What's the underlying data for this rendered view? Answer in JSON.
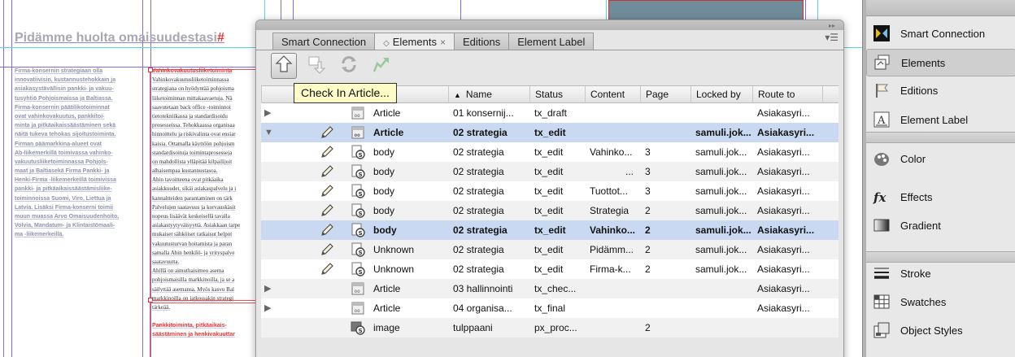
{
  "document": {
    "heading": "Pidämme huolta omaisuudestasi",
    "heading_mark": "#",
    "column1": [
      "Firma-konsernin strategiaan olla",
      "innovatiivisin, kustannustehokkain ja",
      "asiakasystävällisin pankki- ja vakuu-",
      "tusyhtiö Pohjoismaissa ja Baltiassa.",
      "Firma-konsernin päätilikotoiminnat",
      "ovat vahinkovakuutus, pankkitoi-",
      "minta ja pitkäaikaissäästäminen sekä",
      "näitä tukeva tehokas sijoitustoiminta.",
      "Firman päämarkkina-alueet ovat",
      "Ab-liikemerkillä toimivassa vahinko-",
      "vakuutusliiketoiminnassa Pohjois-",
      "maat ja Baltiasekä Firma Pankki- ja",
      "Henki-Firma -liikemerkeillä toimivissa",
      "pankki- ja pitkäaikaissäästämisliike-",
      "toiminnoissa Suomi, Viro, Liettua ja",
      "Latvia. Lisäksi Firma-konserni toimii",
      "muun muassa Arvo Omaisuudenhoito,",
      "Volvia, Mandatum- ja Klintaistömaali-",
      "ma -liikemerkeillä."
    ],
    "column2": [
      {
        "text": "Vahinkovakuutusliiketoiminta",
        "red": true
      },
      {
        "text": "Vahinkovakuutusliiketoiminnassa",
        "red": false
      },
      {
        "text": "strategiana on hyödyntää pohjoisma",
        "red": false
      },
      {
        "text": "liiketoiminnan mittakaavaetuja. Nä",
        "red": false
      },
      {
        "text": "saavutetaan back office -toiminnoi",
        "red": false
      },
      {
        "text": "tietotekniikassa ja standardisoidu",
        "red": false
      },
      {
        "text": "prosesseissa. Tehokkaassa organisaa",
        "red": false
      },
      {
        "text": "hinnoittelu ja riskivalinta ovat ensiar",
        "red": false
      },
      {
        "text": "kaisia. Ottamalla käyttöön pohjoism",
        "red": false
      },
      {
        "text": "standardisoituja toimintaprosesseja",
        "red": false
      },
      {
        "text": "on mahdollista ylläpitää kilpailijoit",
        "red": false
      },
      {
        "text": "alhaisempaa kustannustasoa.",
        "red": false
      },
      {
        "text": "Ahin tavoitteena ovat pitkäaika",
        "red": false
      },
      {
        "text": "asiakkuudet, sikäi asiakaspalvelu ja i",
        "red": false
      },
      {
        "text": "kannaltteiden parantaminen on tärk",
        "red": false
      },
      {
        "text": "Palvelujen saatavuus ja korvauskäsit",
        "red": false
      },
      {
        "text": "nopeus lisäävät keskeisellä tavalla",
        "red": false
      },
      {
        "text": "asiakastyytyväisyyttä. Asiakkaan tarpe",
        "red": false
      },
      {
        "text": "mukaiset sähköiset ratkaisut helpot",
        "red": false
      },
      {
        "text": "vakuutusturvan hoitamista ja paran",
        "red": false
      },
      {
        "text": "samalla Abin henkilö- ja yrityspalve",
        "red": false
      },
      {
        "text": "saatavuutta.",
        "red": false
      },
      {
        "text": "Ahillä on aimuthaisimeo asema",
        "red": false
      },
      {
        "text": "pohjoismaisilla markkinoilla, ja se a",
        "red": false
      },
      {
        "text": "säilyttää asemansa. Myös kasvu Bal",
        "red": false
      },
      {
        "text": "markkinoilla on jatkossakin strategi",
        "red": false
      },
      {
        "text": "tärkeää.",
        "red": false
      },
      {
        "text": "",
        "red": false
      },
      {
        "text": "Pankkitoiminta, pitkäaikais-",
        "red": true
      },
      {
        "text": "säästäminen ja henkivakuuttar",
        "red": true
      }
    ]
  },
  "panel": {
    "tabs": [
      {
        "label": "Smart Connection",
        "active": false,
        "diamond": false,
        "close": false
      },
      {
        "label": "Elements",
        "active": true,
        "diamond": true,
        "close": true
      },
      {
        "label": "Editions",
        "active": false,
        "diamond": false,
        "close": false
      },
      {
        "label": "Element Label",
        "active": false,
        "diamond": false,
        "close": false
      }
    ],
    "diamond_glyph": "◇",
    "close_glyph": "×",
    "collapse_glyph": "▸▸",
    "menu_glyph": "▾☰",
    "toolbar": [
      {
        "name": "check-in-icon",
        "pressed": true
      },
      {
        "name": "check-out-icon",
        "pressed": false
      },
      {
        "name": "update-icon",
        "pressed": false
      },
      {
        "name": "open-in-icon",
        "pressed": false
      }
    ],
    "tooltip": "Check In Article...",
    "columns": [
      {
        "key": "name",
        "label": "Name",
        "sort": "▲"
      },
      {
        "key": "status",
        "label": "Status",
        "sort": ""
      },
      {
        "key": "content",
        "label": "Content",
        "sort": ""
      },
      {
        "key": "page",
        "label": "Page",
        "sort": ""
      },
      {
        "key": "locked_by",
        "label": "Locked by",
        "sort": ""
      },
      {
        "key": "route_to",
        "label": "Route to",
        "sort": ""
      }
    ],
    "rows": [
      {
        "expander": "▶",
        "pencil": false,
        "icon": "article-icon",
        "type": "Article",
        "name": "01 konsernij...",
        "status": "tx_draft",
        "content": "",
        "page": "",
        "locked_by": "",
        "route_to": "Asiakasyri...",
        "selected": false,
        "bold": false
      },
      {
        "expander": "▼",
        "pencil": true,
        "icon": "article-icon",
        "type": "Article",
        "name": "02 strategia",
        "status": "tx_edit",
        "content": "",
        "page": "",
        "locked_by": "samuli.jok...",
        "route_to": "Asiakasyri...",
        "selected": true,
        "bold": true
      },
      {
        "expander": "",
        "pencil": true,
        "icon": "text-component-icon",
        "type": "body",
        "name": "02 strategia",
        "status": "tx_edit",
        "content": "Vahinko...",
        "page": "3",
        "locked_by": "samuli.jok...",
        "route_to": "Asiakasyri...",
        "selected": false,
        "bold": false
      },
      {
        "expander": "",
        "pencil": true,
        "icon": "text-component-icon",
        "type": "body",
        "name": "02 strategia",
        "status": "tx_edit",
        "content": "...",
        "page": "3",
        "locked_by": "samuli.jok...",
        "route_to": "Asiakasyri...",
        "selected": false,
        "bold": false
      },
      {
        "expander": "",
        "pencil": true,
        "icon": "text-component-icon",
        "type": "body",
        "name": "02 strategia",
        "status": "tx_edit",
        "content": "Tuottot...",
        "page": "3",
        "locked_by": "samuli.jok...",
        "route_to": "Asiakasyri...",
        "selected": false,
        "bold": false
      },
      {
        "expander": "",
        "pencil": true,
        "icon": "text-component-icon",
        "type": "body",
        "name": "02 strategia",
        "status": "tx_edit",
        "content": "Strategia",
        "page": "2",
        "locked_by": "samuli.jok...",
        "route_to": "Asiakasyri...",
        "selected": false,
        "bold": false
      },
      {
        "expander": "",
        "pencil": true,
        "icon": "text-component-icon",
        "type": "body",
        "name": "02 strategia",
        "status": "tx_edit",
        "content": "Vahinko...",
        "page": "2",
        "locked_by": "samuli.jok...",
        "route_to": "Asiakasyri...",
        "selected": true,
        "bold": true
      },
      {
        "expander": "",
        "pencil": true,
        "icon": "text-component-icon",
        "type": "Unknown",
        "name": "02 strategia",
        "status": "tx_edit",
        "content": "Pidämm...",
        "page": "2",
        "locked_by": "samuli.jok...",
        "route_to": "Asiakasyri...",
        "selected": false,
        "bold": false
      },
      {
        "expander": "",
        "pencil": true,
        "icon": "text-component-icon",
        "type": "Unknown",
        "name": "02 strategia",
        "status": "tx_edit",
        "content": "Firma-k...",
        "page": "2",
        "locked_by": "samuli.jok...",
        "route_to": "Asiakasyri...",
        "selected": false,
        "bold": false
      },
      {
        "expander": "▶",
        "pencil": false,
        "icon": "article-icon",
        "type": "Article",
        "name": "03 hallinnointi",
        "status": "tx_chec...",
        "content": "",
        "page": "",
        "locked_by": "",
        "route_to": "Asiakasyri...",
        "selected": false,
        "bold": false
      },
      {
        "expander": "▶",
        "pencil": false,
        "icon": "article-icon",
        "type": "Article",
        "name": "04 organisa...",
        "status": "tx_final",
        "content": "",
        "page": "",
        "locked_by": "",
        "route_to": "Asiakasyri...",
        "selected": false,
        "bold": false
      },
      {
        "expander": "",
        "pencil": false,
        "icon": "image-component-icon",
        "type": "image",
        "name": "tulppaani",
        "status": "px_proc...",
        "content": "",
        "page": "2",
        "locked_by": "",
        "route_to": "",
        "selected": false,
        "bold": false
      }
    ]
  },
  "dock": {
    "groups": [
      [
        {
          "label": "Smart Connection",
          "icon": "smart-connection-icon",
          "selected": false
        },
        {
          "label": "Elements",
          "icon": "elements-icon",
          "selected": true
        },
        {
          "label": "Editions",
          "icon": "editions-icon",
          "selected": false
        },
        {
          "label": "Element Label",
          "icon": "element-label-icon",
          "selected": false
        }
      ],
      [
        {
          "label": "Color",
          "icon": "color-icon",
          "selected": false
        },
        {
          "label": "Effects",
          "icon": "effects-icon",
          "selected": false
        },
        {
          "label": "Gradient",
          "icon": "gradient-icon",
          "selected": false
        }
      ],
      [
        {
          "label": "Stroke",
          "icon": "stroke-icon",
          "selected": false
        },
        {
          "label": "Swatches",
          "icon": "swatches-icon",
          "selected": false
        },
        {
          "label": "Object Styles",
          "icon": "object-styles-icon",
          "selected": false
        }
      ]
    ]
  },
  "colors": {
    "selection": "#cad9f2",
    "tooltip_bg": "#fdfcc6",
    "guide_purple": "#8a6ad8",
    "guide_cyan": "#52d8e0",
    "frame_red": "#e55555"
  }
}
